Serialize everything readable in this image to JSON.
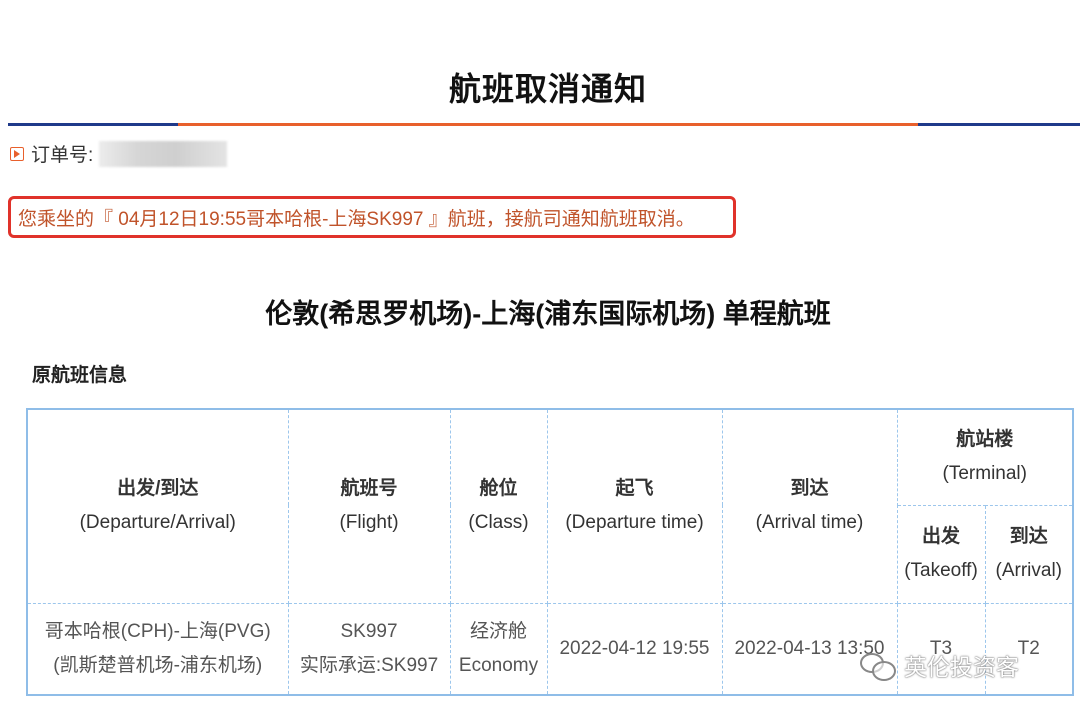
{
  "header": {
    "title": "航班取消通知"
  },
  "order": {
    "label": "订单号:",
    "value_redacted": true
  },
  "notice": {
    "text": "您乘坐的『 04月12日19:55哥本哈根-上海SK997 』航班，接航司通知航班取消。"
  },
  "route": {
    "title": "伦敦(希思罗机场)-上海(浦东国际机场) 单程航班"
  },
  "section": {
    "label": "原航班信息"
  },
  "table": {
    "headers": {
      "dep_arr_zh": "出发/到达",
      "dep_arr_en": "(Departure/Arrival)",
      "flight_zh": "航班号",
      "flight_en": "(Flight)",
      "class_zh": "舱位",
      "class_en": "(Class)",
      "takeoff_zh": "起飞",
      "takeoff_en": "(Departure time)",
      "arrival_zh": "到达",
      "arrival_en": "(Arrival time)",
      "terminal_zh": "航站楼",
      "terminal_en": "(Terminal)",
      "term_dep_zh": "出发",
      "term_dep_en": "(Takeoff)",
      "term_arr_zh": "到达",
      "term_arr_en": "(Arrival)"
    },
    "rows": [
      {
        "route_line1": "哥本哈根(CPH)-上海(PVG)",
        "route_line2": "(凯斯楚普机场-浦东机场)",
        "flight_line1": "SK997",
        "flight_line2": "实际承运:SK997",
        "class_line1": "经济舱",
        "class_line2": "Economy",
        "departure_time": "2022-04-12 19:55",
        "arrival_time": "2022-04-13 13:50",
        "terminal_takeoff": "T3",
        "terminal_arrival": "T2"
      }
    ]
  },
  "watermark": {
    "text": "英伦投资客",
    "icon": "wechat-icon"
  },
  "colors": {
    "accent_orange": "#e8602c",
    "rule_blue": "#1f3a8a",
    "notice_border": "#e0322a",
    "notice_text": "#c0532a",
    "table_border": "#9cc6ec"
  }
}
